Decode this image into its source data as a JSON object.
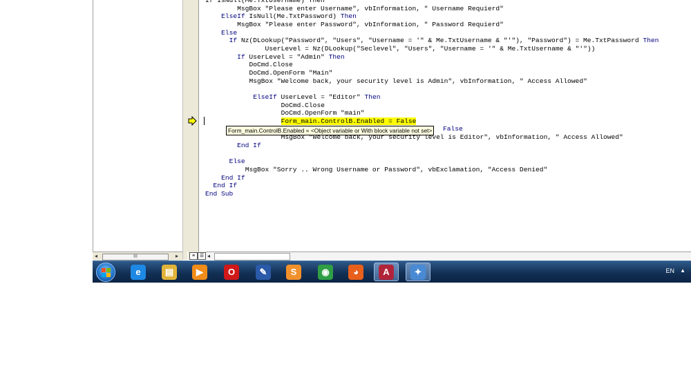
{
  "code_lines": [
    {
      "indent": 0,
      "parts": [
        {
          "t": "If IsNull(Me.TxtUsername) Then",
          "kw": false
        }
      ]
    },
    {
      "indent": 8,
      "parts": [
        {
          "t": "MsgBox \"Please enter Username\", vbInformation, \" Username Requierd\"",
          "kw": false
        }
      ]
    },
    {
      "indent": 4,
      "parts": [
        {
          "t": "ElseIf",
          "kw": true
        },
        {
          "t": " IsNull(Me.TxtPassword) ",
          "kw": false
        },
        {
          "t": "Then",
          "kw": true
        }
      ]
    },
    {
      "indent": 8,
      "parts": [
        {
          "t": "MsgBox \"Please enter Password\", vbInformation, \" Password Requierd\"",
          "kw": false
        }
      ]
    },
    {
      "indent": 4,
      "parts": [
        {
          "t": "Else",
          "kw": true
        }
      ]
    },
    {
      "indent": 6,
      "parts": [
        {
          "t": "If",
          "kw": true
        },
        {
          "t": " Nz(DLookup(\"Password\", \"Users\", \"Username = '\" & Me.TxtUsername & \"'\"), \"Password\") = Me.TxtPassword ",
          "kw": false
        },
        {
          "t": "Then",
          "kw": true
        }
      ]
    },
    {
      "indent": 15,
      "parts": [
        {
          "t": "UserLevel = Nz(DLookup(\"Seclevel\", \"Users\", \"Username = '\" & Me.TxtUsername & \"'\"))",
          "kw": false
        }
      ]
    },
    {
      "indent": 8,
      "parts": [
        {
          "t": "If",
          "kw": true
        },
        {
          "t": " UserLevel = \"Admin\" ",
          "kw": false
        },
        {
          "t": "Then",
          "kw": true
        }
      ]
    },
    {
      "indent": 11,
      "parts": [
        {
          "t": "DoCmd.Close",
          "kw": false
        }
      ]
    },
    {
      "indent": 11,
      "parts": [
        {
          "t": "DoCmd.OpenForm \"Main\"",
          "kw": false
        }
      ]
    },
    {
      "indent": 11,
      "parts": [
        {
          "t": "MsgBox \"Welcome back, your security level is Admin\", vbInformation, \" Access Allowed\"",
          "kw": false
        }
      ]
    },
    {
      "indent": 0,
      "parts": [
        {
          "t": "",
          "kw": false
        }
      ]
    },
    {
      "indent": 12,
      "parts": [
        {
          "t": "ElseIf",
          "kw": true
        },
        {
          "t": " UserLevel = \"Editor\" ",
          "kw": false
        },
        {
          "t": "Then",
          "kw": true
        }
      ]
    },
    {
      "indent": 19,
      "parts": [
        {
          "t": "DoCmd.Close",
          "kw": false
        }
      ]
    },
    {
      "indent": 19,
      "parts": [
        {
          "t": "DoCmd.OpenForm \"main\"",
          "kw": false
        }
      ]
    },
    {
      "indent": 19,
      "parts": [
        {
          "t": "Form_main.ControlB.Enabled = False",
          "kw": false,
          "hl": true
        }
      ]
    },
    {
      "indent": 0,
      "parts": [
        {
          "t": "",
          "kw": false
        }
      ]
    },
    {
      "indent": 19,
      "parts": [
        {
          "t": "MsgBox \"Welcome back, your security level is Editor\", vbInformation, \" Access Allowed\"",
          "kw": false
        }
      ]
    },
    {
      "indent": 8,
      "parts": [
        {
          "t": "End If",
          "kw": true
        }
      ]
    },
    {
      "indent": 0,
      "parts": [
        {
          "t": "",
          "kw": false
        }
      ]
    },
    {
      "indent": 6,
      "parts": [
        {
          "t": "Else",
          "kw": true
        }
      ]
    },
    {
      "indent": 10,
      "parts": [
        {
          "t": "MsgBox \"Sorry .. Wrong Username or Password\", vbExclamation, \"Access Denied\"",
          "kw": false
        }
      ]
    },
    {
      "indent": 4,
      "parts": [
        {
          "t": "End If",
          "kw": true
        }
      ]
    },
    {
      "indent": 2,
      "parts": [
        {
          "t": "End If",
          "kw": true
        }
      ]
    },
    {
      "indent": 0,
      "parts": [
        {
          "t": "End Sub",
          "kw": true
        }
      ]
    }
  ],
  "tooltip": {
    "text": "Form_main.ControlB.Enabled = <Object variable or With block variable not set>",
    "tail": "False"
  },
  "scrollbar": {
    "thumb_glyph": "III"
  },
  "taskbar": {
    "items": [
      {
        "name": "internet-explorer",
        "glyph": "e",
        "color": "#1e88e5"
      },
      {
        "name": "file-explorer",
        "glyph": "▤",
        "color": "#e2b33a"
      },
      {
        "name": "media-player",
        "glyph": "▶",
        "color": "#f08c1a"
      },
      {
        "name": "opera",
        "glyph": "O",
        "color": "#d01818"
      },
      {
        "name": "app-blue",
        "glyph": "✎",
        "color": "#2a5aa8"
      },
      {
        "name": "sublime-text",
        "glyph": "S",
        "color": "#f2912c"
      },
      {
        "name": "chrome",
        "glyph": "◉",
        "color": "#2f9e44"
      },
      {
        "name": "firefox",
        "glyph": "◕",
        "color": "#e8601c"
      },
      {
        "name": "ms-access",
        "glyph": "A",
        "color": "#b0243a",
        "active": true
      },
      {
        "name": "paint",
        "glyph": "✦",
        "color": "#4a8ad4",
        "active": true
      }
    ],
    "language": "EN",
    "tray_arrow": "▲"
  }
}
